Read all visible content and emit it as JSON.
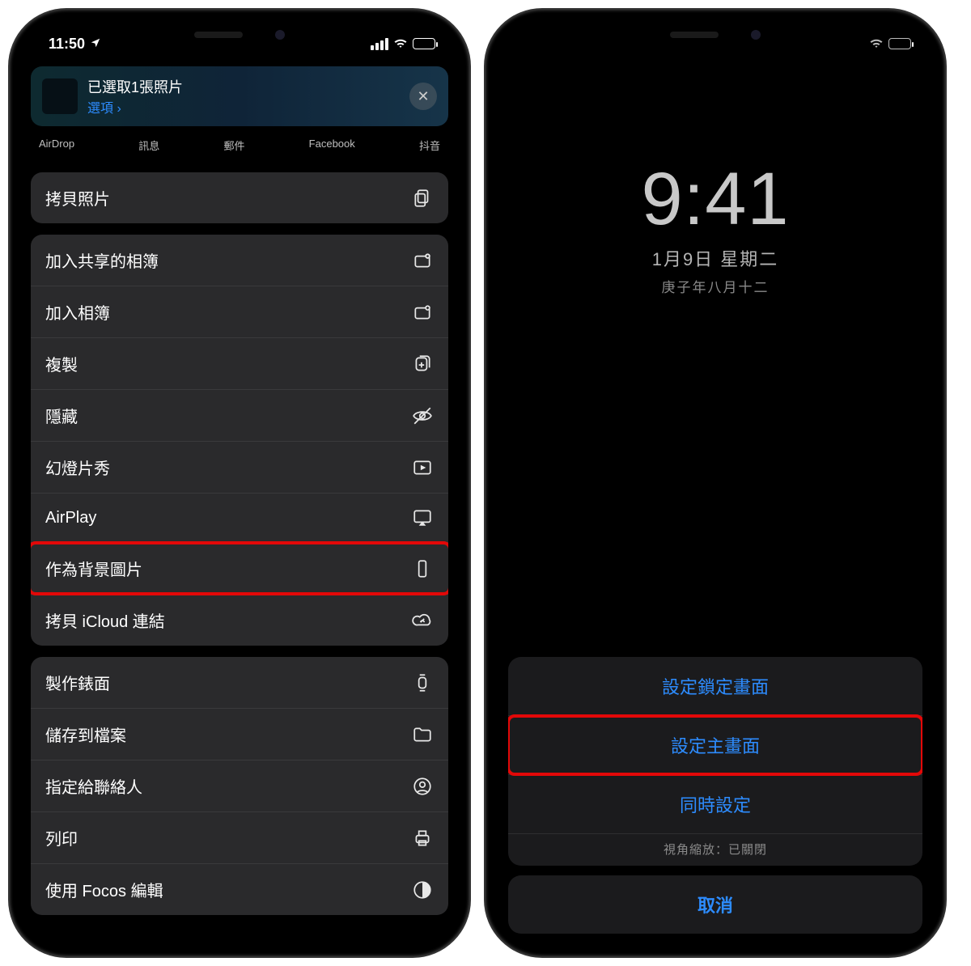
{
  "left": {
    "status": {
      "time": "11:50"
    },
    "header": {
      "title": "已選取1張照片",
      "options": "選項 ›"
    },
    "apps": [
      "AirDrop",
      "訊息",
      "郵件",
      "Facebook",
      "抖音"
    ],
    "group1": [
      {
        "label": "拷貝照片",
        "icon": "copy-pages"
      }
    ],
    "group2": [
      {
        "label": "加入共享的相簿",
        "icon": "shared-album"
      },
      {
        "label": "加入相簿",
        "icon": "add-album"
      },
      {
        "label": "複製",
        "icon": "duplicate"
      },
      {
        "label": "隱藏",
        "icon": "hide"
      },
      {
        "label": "幻燈片秀",
        "icon": "slideshow"
      },
      {
        "label": "AirPlay",
        "icon": "airplay"
      },
      {
        "label": "作為背景圖片",
        "icon": "wallpaper",
        "highlight": true
      },
      {
        "label": "拷貝 iCloud 連結",
        "icon": "icloud-link"
      }
    ],
    "group3": [
      {
        "label": "製作錶面",
        "icon": "watch"
      },
      {
        "label": "儲存到檔案",
        "icon": "folder"
      },
      {
        "label": "指定給聯絡人",
        "icon": "contact"
      },
      {
        "label": "列印",
        "icon": "print"
      },
      {
        "label": "使用 Focos 編輯",
        "icon": "focos"
      }
    ]
  },
  "right": {
    "lock": {
      "time": "9:41",
      "date1": "1月9日 星期二",
      "date2": "庚子年八月十二"
    },
    "options": {
      "set_lock": "設定鎖定畫面",
      "set_home": "設定主畫面",
      "set_both": "同時設定",
      "note": "視角縮放：已關閉",
      "cancel": "取消",
      "highlight_index": 1
    }
  }
}
